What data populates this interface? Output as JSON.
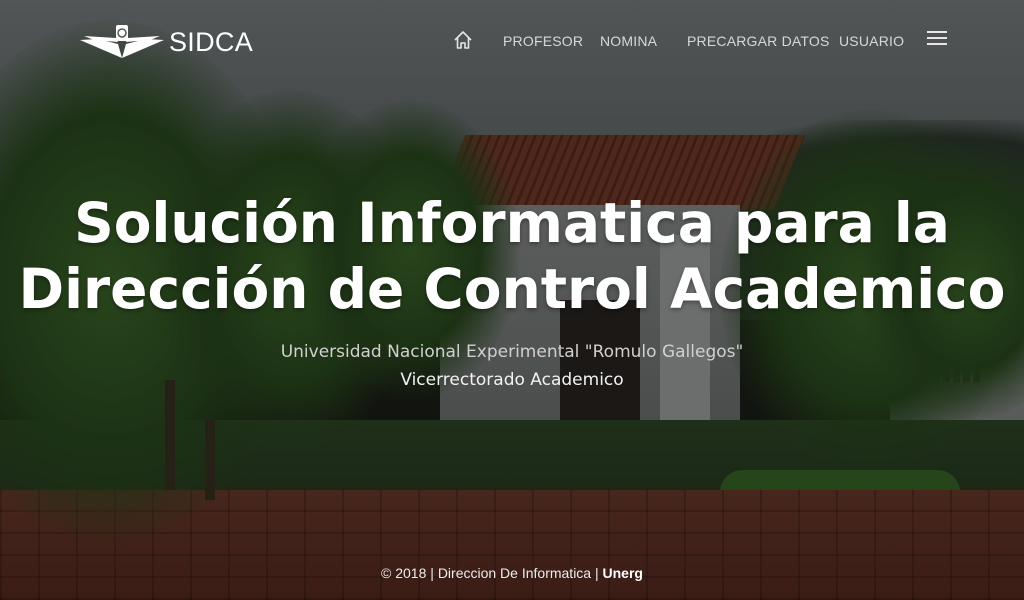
{
  "brand": {
    "logo_icon": "eagle-wings-logo-icon",
    "name": "SIDCA"
  },
  "nav": {
    "home_icon": "home-icon",
    "items": [
      {
        "label": "PROFESOR"
      },
      {
        "label": "NOMINA"
      },
      {
        "label": "PRECARGAR DATOS"
      },
      {
        "label": "USUARIO"
      }
    ],
    "menu_icon": "hamburger-menu-icon"
  },
  "hero": {
    "title_line1": "Solución Informatica para la",
    "title_line2": "Dirección de Control Academico",
    "subtitle": "Universidad Nacional Experimental \"Romulo Gallegos\"",
    "subtitle2": "Vicerrectorado Academico"
  },
  "footer": {
    "copyright": "© 2018",
    "separator": "|",
    "department": "Direccion De Informatica",
    "org": "Unerg"
  },
  "colors": {
    "text": "#ffffff",
    "nav_text": "#d8d8d8",
    "overlay": "#000000"
  }
}
